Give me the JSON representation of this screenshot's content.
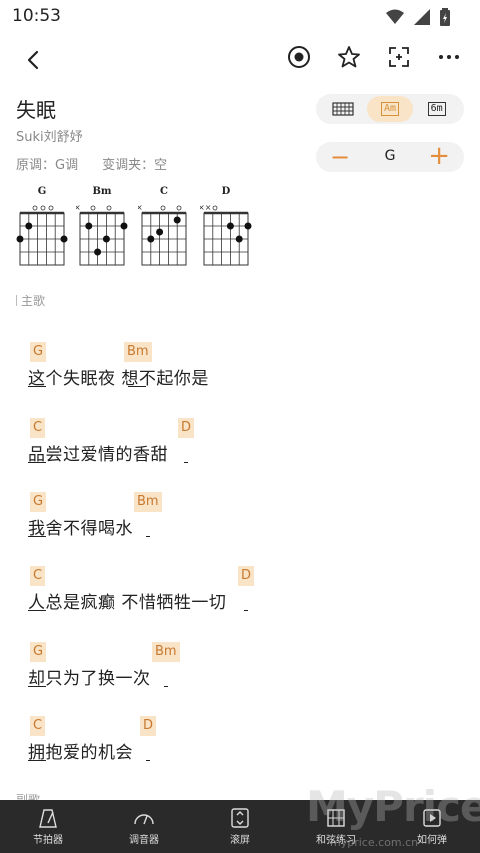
{
  "status": {
    "time": "10:53"
  },
  "song": {
    "title": "失眠",
    "artist": "Suki刘舒妤",
    "original_key": "原调：G调",
    "capo": "变调夹：空"
  },
  "view_toggle": {
    "items": [
      "Am",
      "6m"
    ],
    "active": "Am"
  },
  "transpose": {
    "minus": "−",
    "key": "G",
    "plus": "+"
  },
  "chords": [
    "G",
    "Bm",
    "C",
    "D"
  ],
  "sections": {
    "verse": "主歌",
    "chorus": "副歌"
  },
  "lyrics": [
    {
      "text": "这个失眠夜 想不起你是",
      "chords": [
        {
          "name": "G"
        },
        {
          "name": "Bm"
        }
      ]
    },
    {
      "text": "品尝过爱情的香甜",
      "chords": [
        {
          "name": "C"
        },
        {
          "name": "D"
        }
      ]
    },
    {
      "text": "我舍不得喝水",
      "chords": [
        {
          "name": "G"
        },
        {
          "name": "Bm"
        }
      ]
    },
    {
      "text": "人总是疯癫 不惜牺牲一切",
      "chords": [
        {
          "name": "C"
        },
        {
          "name": "D"
        }
      ]
    },
    {
      "text": "却只为了换一次",
      "chords": [
        {
          "name": "G"
        },
        {
          "name": "Bm"
        }
      ]
    },
    {
      "text": "拥抱爱的机会",
      "chords": [
        {
          "name": "C"
        },
        {
          "name": "D"
        }
      ]
    }
  ],
  "bottom_nav": [
    "节拍器",
    "调音器",
    "滚屏",
    "和弦练习",
    "如何弹"
  ],
  "watermark": {
    "main": "MyPrice",
    "sub": "myprice.com.cn"
  },
  "colors": {
    "accent": "#e58d3b",
    "chord_bg": "#f9e4c8",
    "chord_text": "#c8792f",
    "bottom_bar": "#2a2a2a"
  }
}
